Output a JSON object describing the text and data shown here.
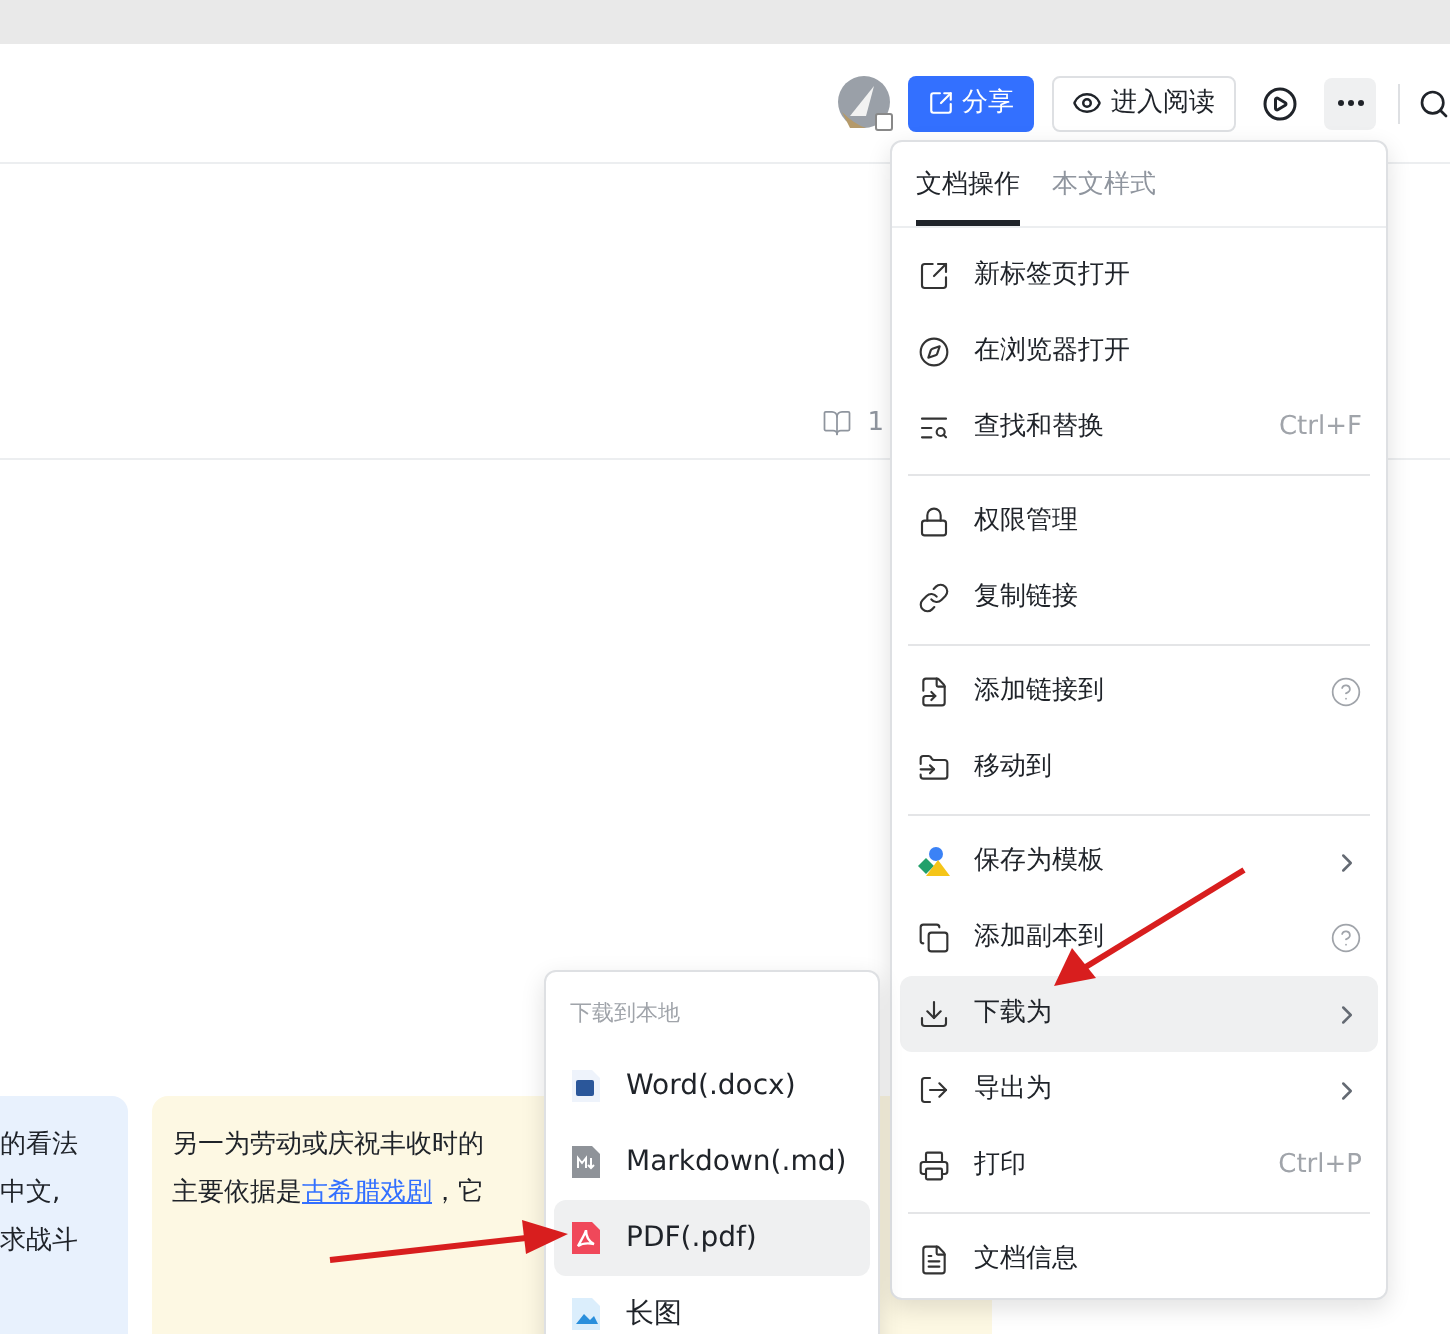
{
  "toolbar": {
    "share_button": "分享",
    "read_button": "进入阅读"
  },
  "reading_count": "1",
  "cards": [
    {
      "color": "#e8f1fd",
      "lines": [
        [
          {
            "kind": "text",
            "text": "的看法"
          }
        ],
        [
          {
            "kind": "text",
            "text": "中文,"
          }
        ],
        [
          {
            "kind": "text",
            "text": "求战斗"
          }
        ]
      ]
    },
    {
      "color": "#fdf8e3",
      "lines": [
        [
          {
            "kind": "text",
            "text": "另一为劳动或庆祝丰收时的"
          }
        ],
        [
          {
            "kind": "text",
            "text": "主要依据是"
          },
          {
            "kind": "link",
            "text": "古希腊戏剧"
          },
          {
            "kind": "text",
            "text": "，它"
          }
        ]
      ]
    }
  ],
  "menu": {
    "tabs": [
      {
        "label": "文档操作",
        "selected": true
      },
      {
        "label": "本文样式",
        "selected": false
      }
    ],
    "groups": [
      [
        {
          "label": "新标签页打开",
          "selected": false
        },
        {
          "label": "在浏览器打开",
          "selected": false
        },
        {
          "label": "查找和替换",
          "shortcut": "Ctrl+F",
          "selected": false
        }
      ],
      [
        {
          "label": "权限管理",
          "selected": false
        },
        {
          "label": "复制链接",
          "selected": false
        }
      ],
      [
        {
          "label": "添加链接到",
          "help": true,
          "selected": false
        },
        {
          "label": "移动到",
          "selected": false
        }
      ],
      [
        {
          "label": "保存为模板",
          "submenu": true,
          "selected": false
        },
        {
          "label": "添加副本到",
          "help": true,
          "selected": false
        },
        {
          "label": "下载为",
          "submenu": true,
          "selected": true
        },
        {
          "label": "导出为",
          "submenu": true,
          "selected": false
        },
        {
          "label": "打印",
          "shortcut": "Ctrl+P",
          "selected": false
        }
      ],
      [
        {
          "label": "文档信息",
          "selected": false
        }
      ]
    ]
  },
  "submenu": {
    "title": "下载到本地",
    "items": [
      {
        "kind": "word",
        "label": "Word(.docx)",
        "selected": false
      },
      {
        "kind": "markdown",
        "label": "Markdown(.md)",
        "selected": false
      },
      {
        "kind": "pdf",
        "label": "PDF(.pdf)",
        "selected": true
      },
      {
        "kind": "image",
        "label": "长图",
        "selected": false
      }
    ]
  }
}
